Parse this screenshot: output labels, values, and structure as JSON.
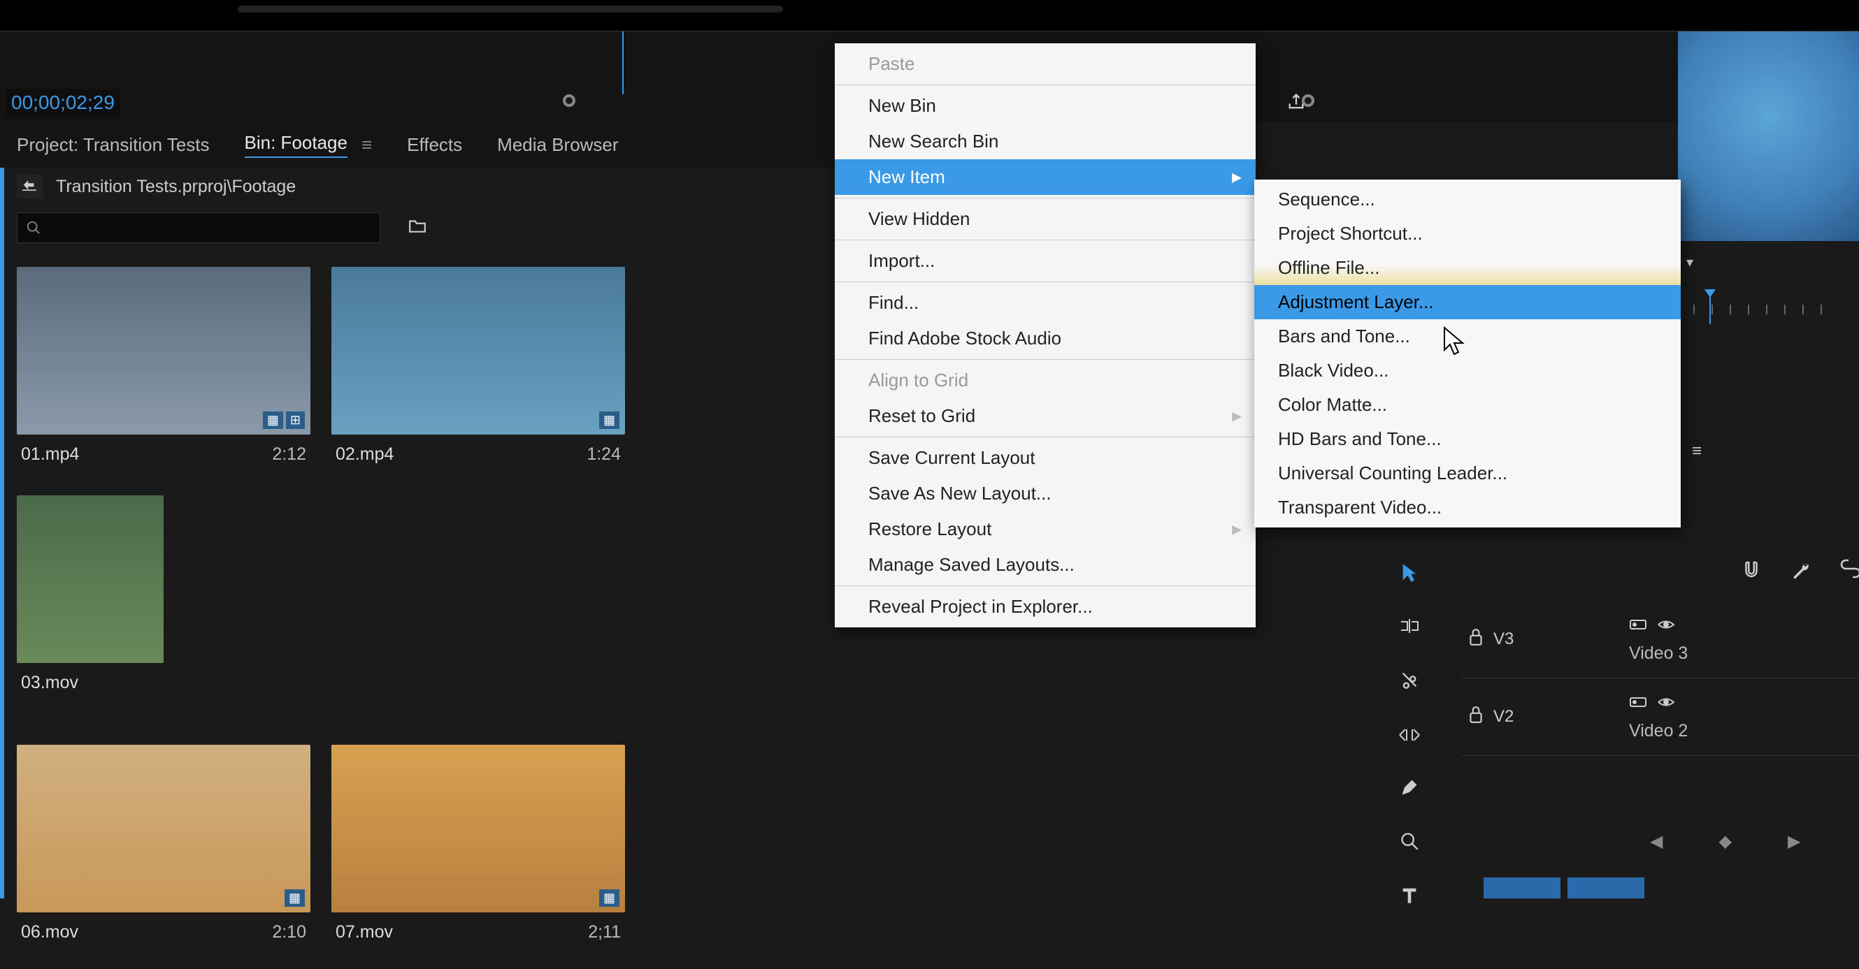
{
  "timecode": "00;00;02;29",
  "tabs": {
    "project": "Project: Transition Tests",
    "bin": "Bin: Footage",
    "effects": "Effects",
    "mediaBrowser": "Media Browser"
  },
  "breadcrumb": "Transition Tests.prproj\\Footage",
  "contextMenu": {
    "paste": "Paste",
    "newBin": "New Bin",
    "newSearchBin": "New Search Bin",
    "newItem": "New Item",
    "viewHidden": "View Hidden",
    "import": "Import...",
    "find": "Find...",
    "findStock": "Find Adobe Stock Audio",
    "alignGrid": "Align to Grid",
    "resetGrid": "Reset to Grid",
    "saveLayout": "Save Current Layout",
    "saveAsLayout": "Save As New Layout...",
    "restoreLayout": "Restore Layout",
    "manageLayouts": "Manage Saved Layouts...",
    "reveal": "Reveal Project in Explorer..."
  },
  "subMenu": {
    "sequence": "Sequence...",
    "shortcut": "Project Shortcut...",
    "offline": "Offline File...",
    "adjustment": "Adjustment Layer...",
    "bars": "Bars and Tone...",
    "black": "Black Video...",
    "matte": "Color Matte...",
    "hdbars": "HD Bars and Tone...",
    "ucl": "Universal Counting Leader...",
    "transparent": "Transparent Video..."
  },
  "clips": {
    "c1": {
      "name": "01.mp4",
      "dur": "2:12"
    },
    "c2": {
      "name": "02.mp4",
      "dur": "1:24"
    },
    "c3": {
      "name": "03.mov",
      "dur": ""
    },
    "c4": {
      "name": "06.mov",
      "dur": "2:10"
    },
    "c5": {
      "name": "07.mov",
      "dur": "2;11"
    }
  },
  "tracks": {
    "v3": {
      "num": "V3",
      "name": "Video 3"
    },
    "v2": {
      "num": "V2",
      "name": "Video 2"
    }
  },
  "icons": {
    "search": "search-icon",
    "folder": "folder-icon"
  }
}
